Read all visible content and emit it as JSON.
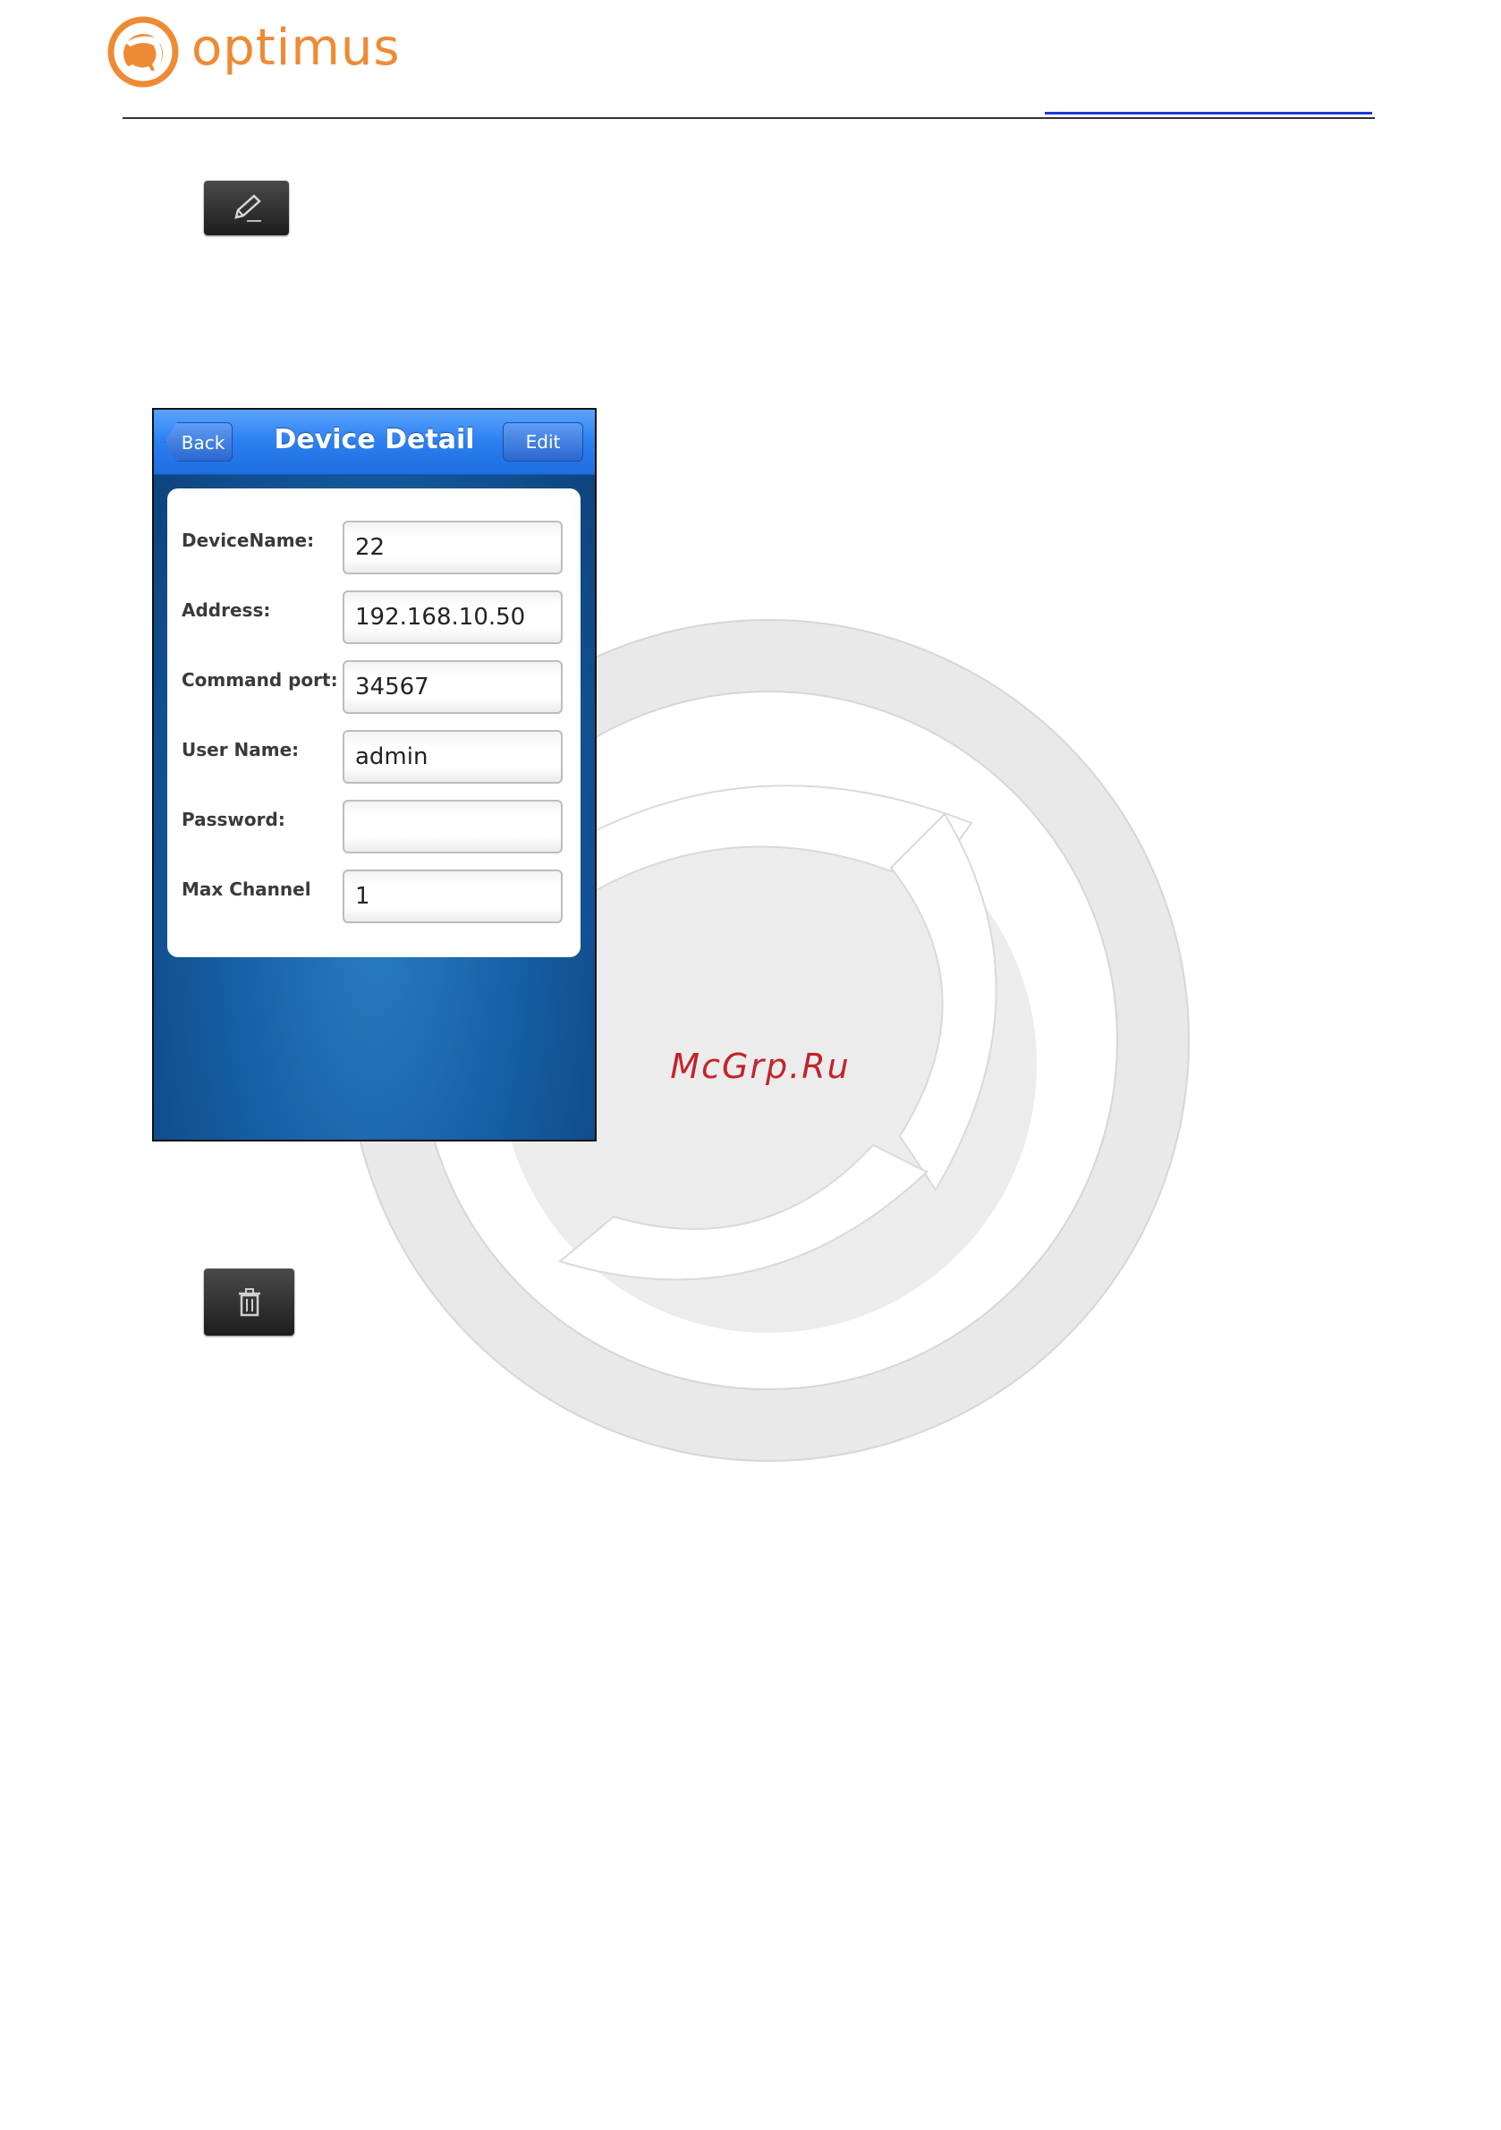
{
  "brand": {
    "name": "optimus",
    "accent": "#ef8a34"
  },
  "icons": {
    "edit": "pencil-icon",
    "delete": "trash-icon"
  },
  "watermark": {
    "text": "McGrp.Ru",
    "color": "#c2242c"
  },
  "screen": {
    "nav": {
      "back_label": "Back",
      "title": "Device Detail",
      "edit_label": "Edit"
    },
    "fields": [
      {
        "label": "DeviceName:",
        "value": "22"
      },
      {
        "label": "Address:",
        "value": "192.168.10.50"
      },
      {
        "label": "Command port:",
        "value": "34567"
      },
      {
        "label": "User Name:",
        "value": "admin"
      },
      {
        "label": "Password:",
        "value": ""
      },
      {
        "label": "Max Channel",
        "value": "1"
      }
    ]
  }
}
